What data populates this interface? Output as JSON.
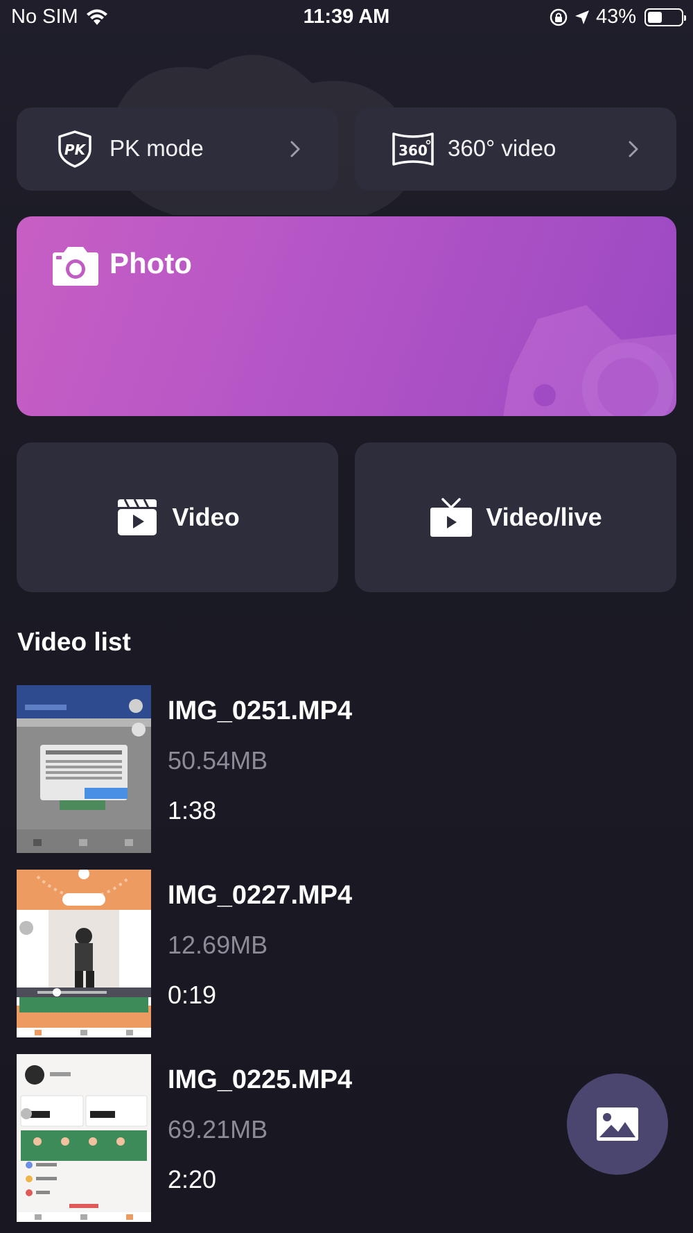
{
  "status_bar": {
    "carrier": "No SIM",
    "time": "11:39 AM",
    "battery": "43%",
    "battery_level": 0.43
  },
  "modes": [
    {
      "label": "PK mode",
      "icon": "pk-shield-icon"
    },
    {
      "label": "360° video",
      "icon": "360-icon"
    }
  ],
  "photo": {
    "label": "Photo",
    "icon": "camera-icon"
  },
  "actions": [
    {
      "label": "Video",
      "icon": "clapperboard-icon"
    },
    {
      "label": "Video/live",
      "icon": "tv-live-icon"
    }
  ],
  "video_list": {
    "title": "Video list",
    "items": [
      {
        "name": "IMG_0251.MP4",
        "size": "50.54MB",
        "duration": "1:38"
      },
      {
        "name": "IMG_0227.MP4",
        "size": "12.69MB",
        "duration": "0:19"
      },
      {
        "name": "IMG_0225.MP4",
        "size": "69.21MB",
        "duration": "2:20"
      }
    ]
  },
  "colors": {
    "background": "#1b1a25",
    "card": "#2e2d3b",
    "photo_gradient_start": "#c75fc4",
    "photo_gradient_end": "#9b49c3",
    "fab": "#4b4670"
  }
}
